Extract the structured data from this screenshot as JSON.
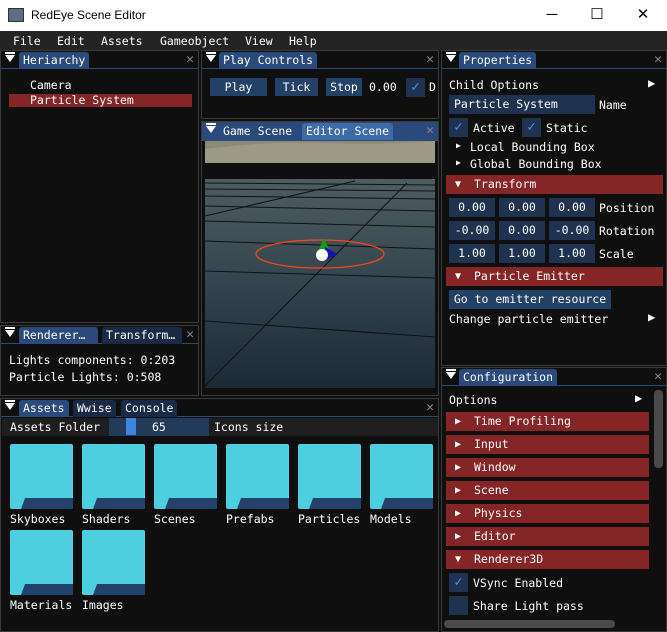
{
  "window": {
    "title": "RedEye Scene Editor",
    "controls": [
      "minimize",
      "maximize",
      "close"
    ]
  },
  "menu": [
    "File",
    "Edit",
    "Assets",
    "Gameobject",
    "View",
    "Help"
  ],
  "hierarchy": {
    "tab": "Heriarchy",
    "items": [
      {
        "label": "Camera",
        "selected": false
      },
      {
        "label": "Particle System",
        "selected": true
      }
    ]
  },
  "play_controls": {
    "tab": "Play Controls",
    "play": "Play",
    "tick": "Tick",
    "stop": "Stop",
    "time": "0.00",
    "checkbox_label": "D",
    "checked": true
  },
  "scene": {
    "tabs": [
      "Game Scene",
      "Editor Scene"
    ],
    "active": "Editor Scene"
  },
  "renderer": {
    "tabs": [
      "Renderer…",
      "Transform…"
    ],
    "lines": [
      "Lights components: 0:203",
      "Particle Lights: 0:508"
    ]
  },
  "assets": {
    "tabs": [
      "Assets",
      "Wwise",
      "Console"
    ],
    "folder_label": "Assets Folder",
    "icons_size": "65",
    "icons_size_label": "Icons size",
    "folders": [
      "Skyboxes",
      "Shaders",
      "Scenes",
      "Prefabs",
      "Particles",
      "Models",
      "Materials",
      "Images"
    ]
  },
  "properties": {
    "tab": "Properties",
    "child_options": "Child Options",
    "name_value": "Particle System",
    "name_label": "Name",
    "active_label": "Active",
    "active": true,
    "static_label": "Static",
    "static": true,
    "local_bb": "Local Bounding Box",
    "global_bb": "Global Bounding Box",
    "transform": "Transform",
    "position": [
      "0.00",
      "0.00",
      "0.00"
    ],
    "position_label": "Position",
    "rotation": [
      "-0.00",
      "0.00",
      "-0.00"
    ],
    "rotation_label": "Rotation",
    "scale": [
      "1.00",
      "1.00",
      "1.00"
    ],
    "scale_label": "Scale",
    "emitter": "Particle Emitter",
    "go_emitter": "Go to emitter resource",
    "change_emitter": "Change particle emitter"
  },
  "configuration": {
    "tab": "Configuration",
    "options": "Options",
    "headers": [
      "Time Profiling",
      "Input",
      "Window",
      "Scene",
      "Physics",
      "Editor"
    ],
    "open_header": "Renderer3D",
    "vsync_label": "VSync Enabled",
    "vsync": true,
    "share_label": "Share Light pass",
    "share": false
  },
  "colors": {
    "accent": "#294a7a",
    "header_red": "#862525",
    "folder": "#4ecfe0",
    "check": "#4296fa"
  }
}
